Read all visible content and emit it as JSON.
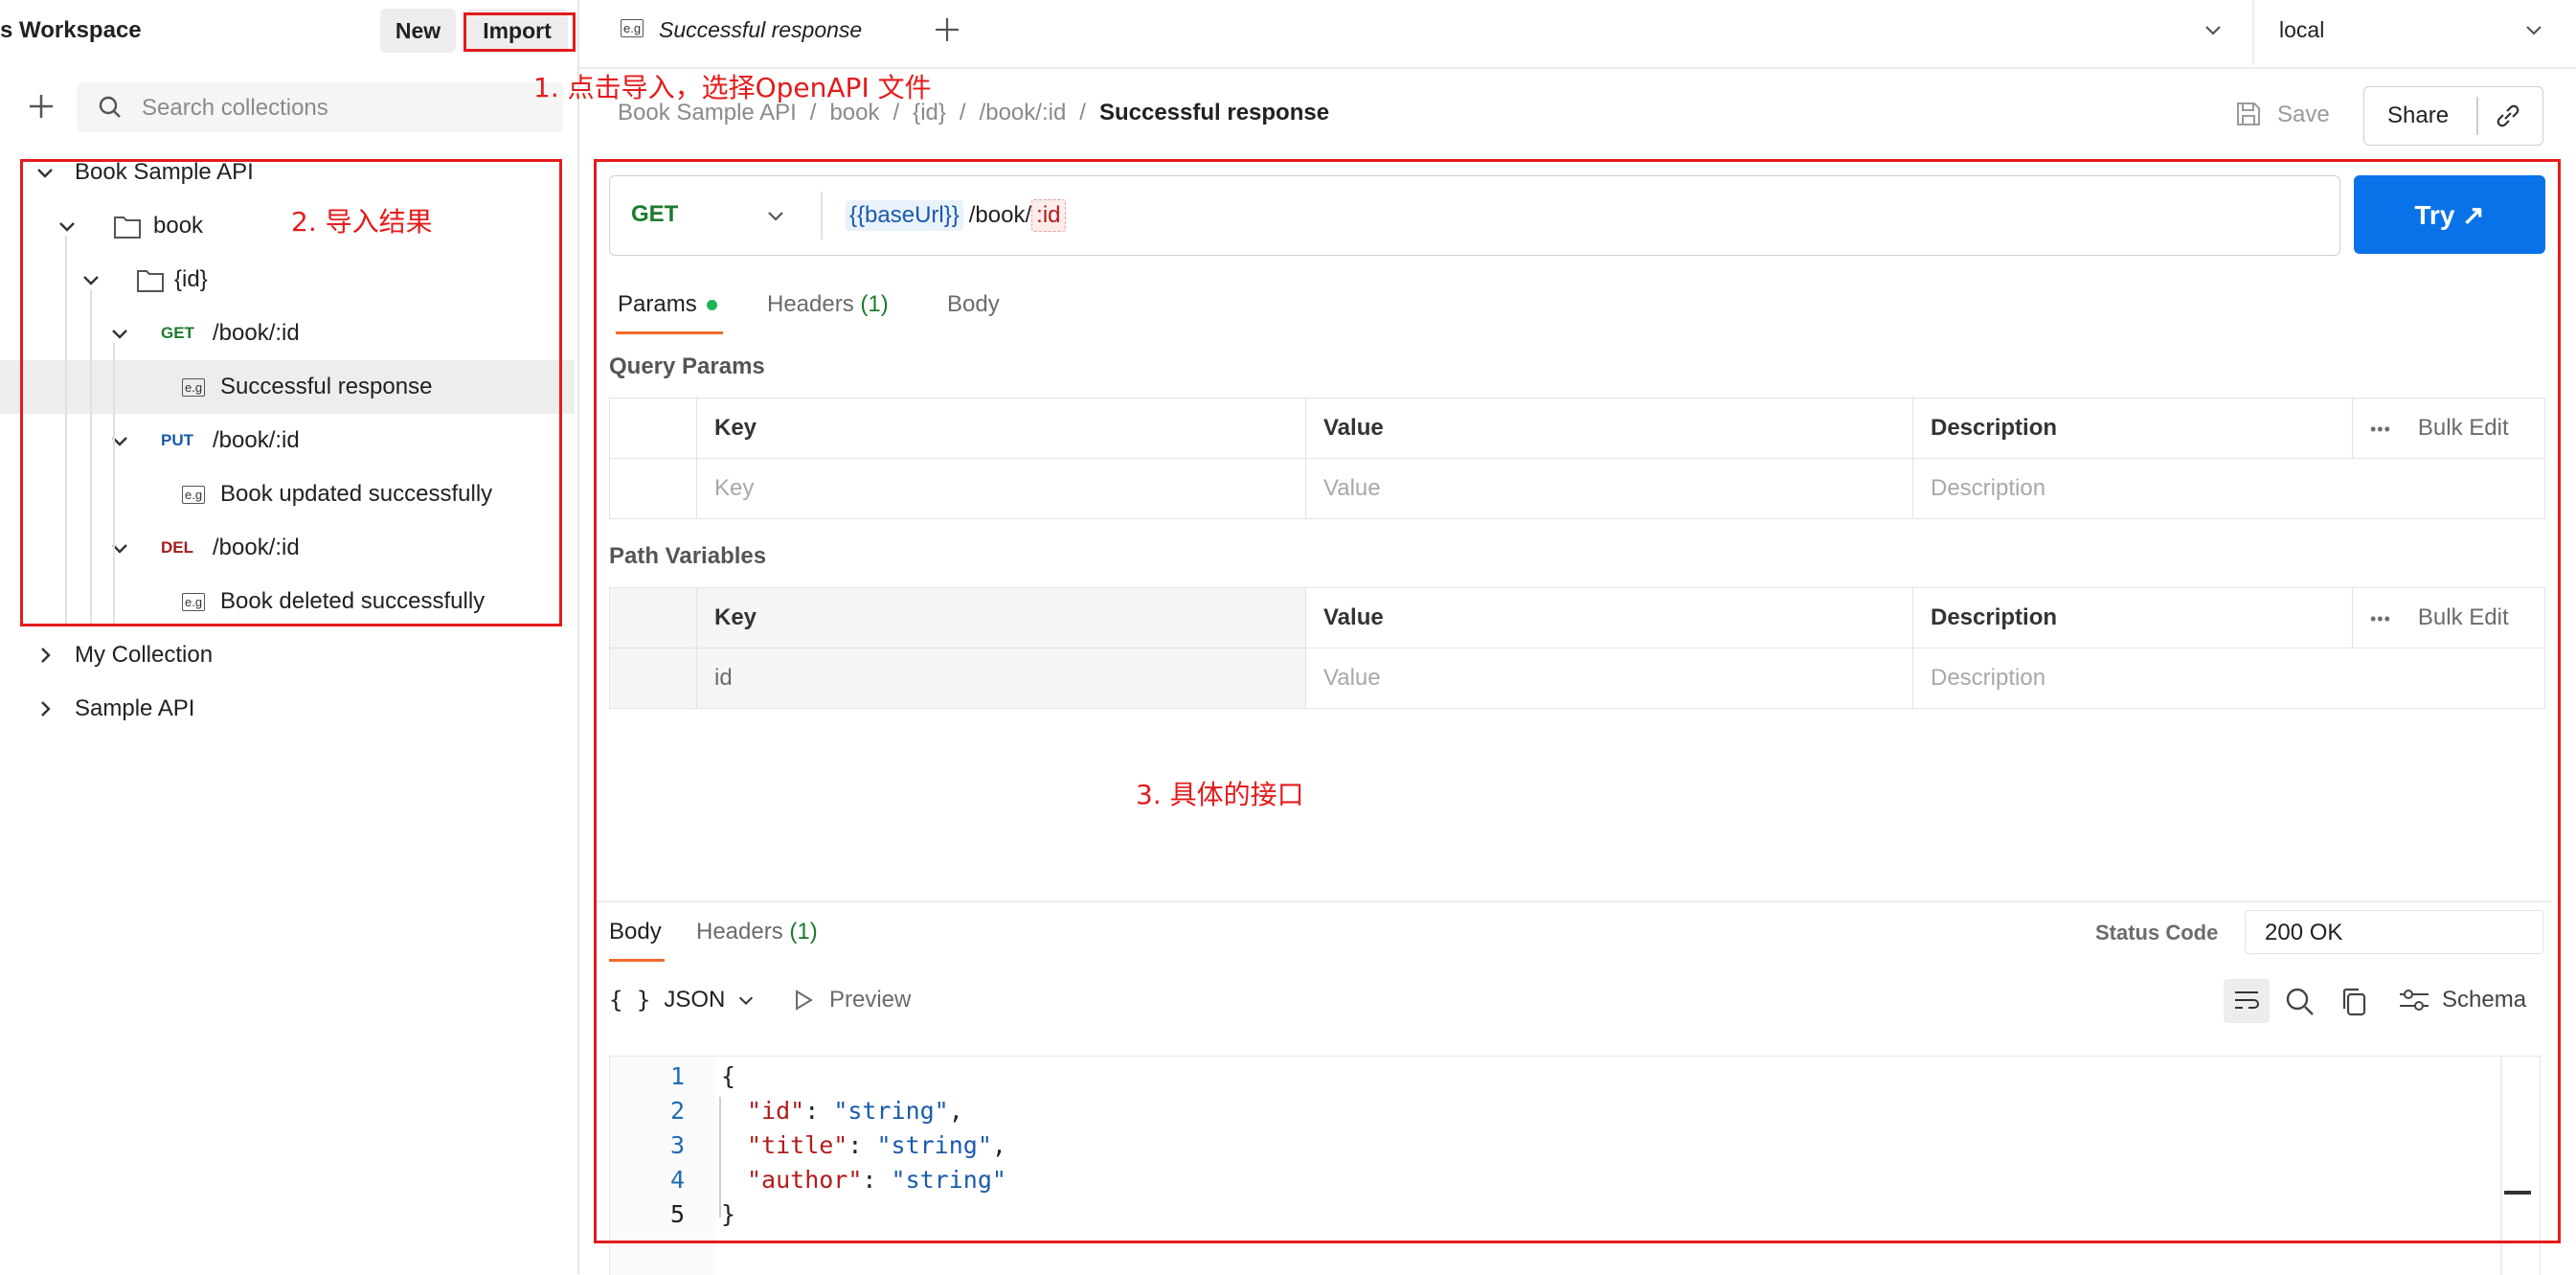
{
  "sidebar": {
    "workspace_title": "s Workspace",
    "new_label": "New",
    "import_label": "Import",
    "search_placeholder": "Search collections",
    "tree": [
      {
        "label": "Book Sample API"
      },
      {
        "label": "book"
      },
      {
        "label": "{id}"
      },
      {
        "method": "GET",
        "label": "/book/:id",
        "method_color": "#1b7b2b"
      },
      {
        "label": "Successful response"
      },
      {
        "method": "PUT",
        "label": "/book/:id",
        "method_color": "#1a5aab"
      },
      {
        "label": "Book updated successfully"
      },
      {
        "method": "DEL",
        "label": "/book/:id",
        "method_color": "#a31b1b"
      },
      {
        "label": "Book deleted successfully"
      },
      {
        "label": "My Collection"
      },
      {
        "label": "Sample API"
      }
    ],
    "example_icon_text": "e.g"
  },
  "tabs": {
    "active_tab": "Successful response",
    "environment": "local"
  },
  "breadcrumb": [
    "Book Sample API",
    "book",
    "{id}",
    "/book/:id",
    "Successful response"
  ],
  "actions": {
    "save": "Save",
    "share": "Share"
  },
  "request": {
    "method": "GET",
    "url_var": "{{baseUrl}}",
    "url_path": "/book/",
    "url_param": ":id",
    "try_label": "Try ↗"
  },
  "request_tabs": {
    "params": "Params",
    "headers": "Headers",
    "headers_count": "(1)",
    "body": "Body"
  },
  "query_params": {
    "title": "Query Params",
    "headers": [
      "Key",
      "Value",
      "Description"
    ],
    "bulk_edit": "Bulk Edit",
    "placeholders": [
      "Key",
      "Value",
      "Description"
    ]
  },
  "path_variables": {
    "title": "Path Variables",
    "headers": [
      "Key",
      "Value",
      "Description"
    ],
    "bulk_edit": "Bulk Edit",
    "row": [
      "id",
      "Value",
      "Description"
    ]
  },
  "response": {
    "tabs": {
      "body": "Body",
      "headers": "Headers",
      "headers_count": "(1)"
    },
    "status_label": "Status Code",
    "status_value": "200 OK",
    "format": "JSON",
    "format_icon": "{ }",
    "preview": "Preview",
    "schema": "Schema",
    "code_lines": [
      {
        "n": "1",
        "text": "{"
      },
      {
        "n": "2",
        "key": "\"id\"",
        "val": "\"string\"",
        "tail": ","
      },
      {
        "n": "3",
        "key": "\"title\"",
        "val": "\"string\"",
        "tail": ","
      },
      {
        "n": "4",
        "key": "\"author\"",
        "val": "\"string\"",
        "tail": ""
      },
      {
        "n": "5",
        "text": "}"
      }
    ]
  },
  "annotations": {
    "import": "1. 点击导入，选择OpenAPI 文件",
    "result": "2. 导入结果",
    "api": "3. 具体的接口"
  },
  "colors": {
    "accent": "#0a72e8",
    "annotation": "#e41b1b",
    "active_tab_underline": "#f06b2b"
  }
}
